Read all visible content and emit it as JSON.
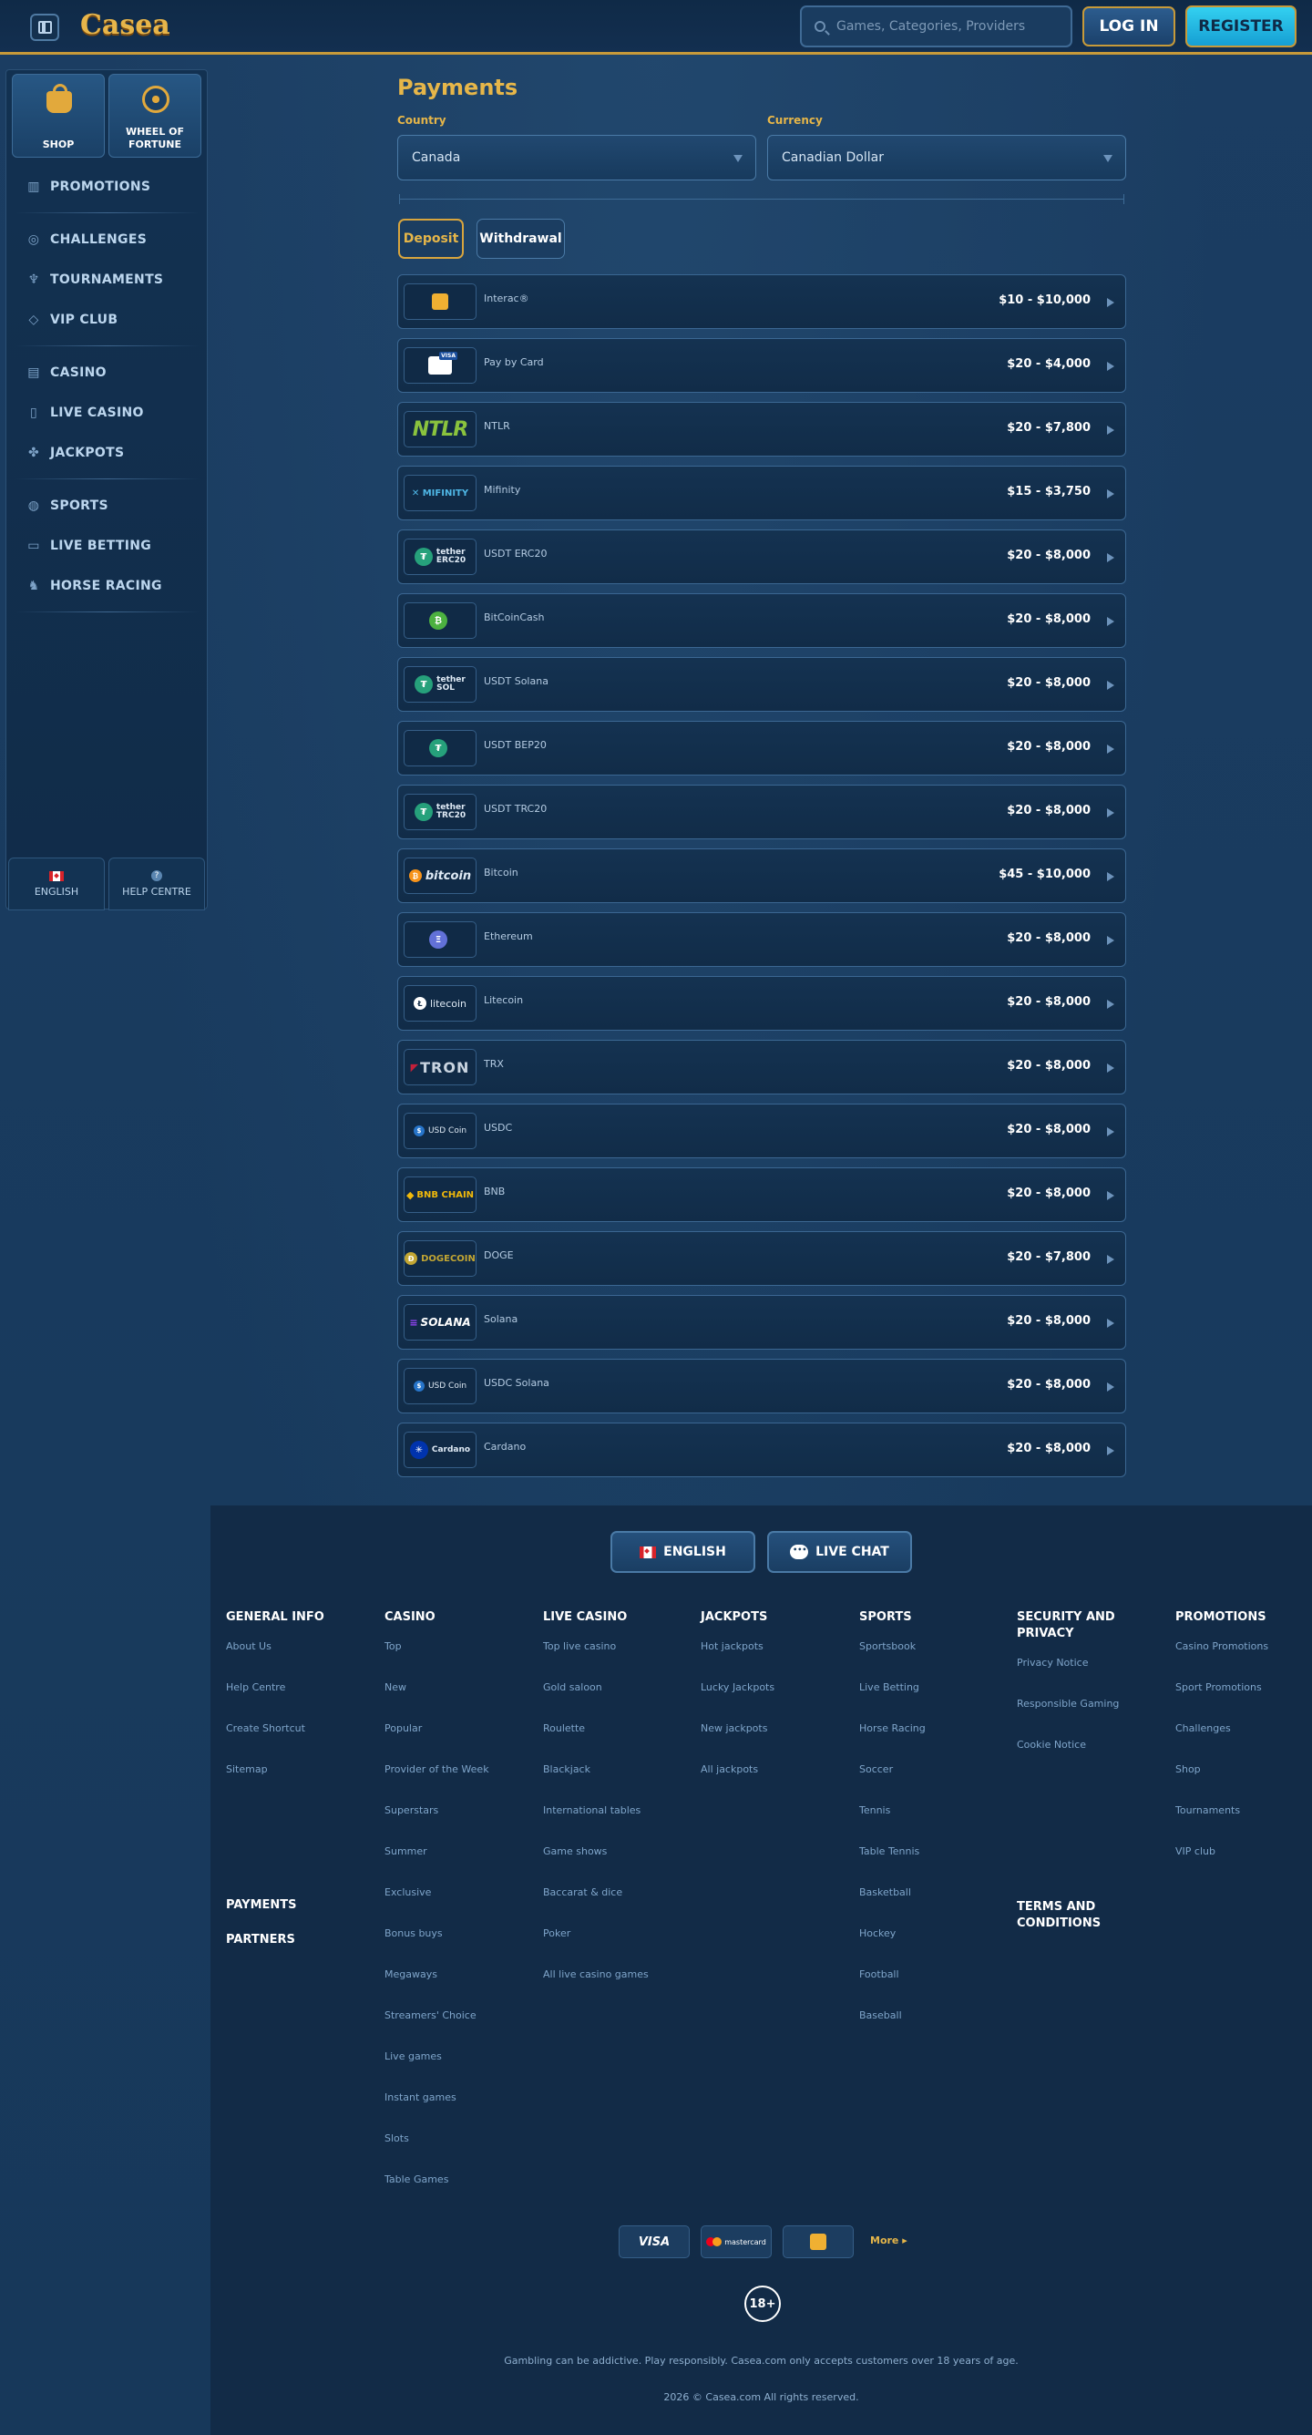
{
  "header": {
    "logo": "Casea",
    "search_placeholder": "Games, Categories, Providers",
    "login_label": "LOG IN",
    "register_label": "REGISTER"
  },
  "sidebar": {
    "tiles": [
      {
        "label": "SHOP",
        "icon": "shopping-bag-icon"
      },
      {
        "label": "WHEEL OF FORTUNE",
        "icon": "wheel-icon"
      }
    ],
    "groups": [
      [
        {
          "label": "PROMOTIONS",
          "icon": "gift-icon"
        }
      ],
      [
        {
          "label": "CHALLENGES",
          "icon": "target-icon"
        },
        {
          "label": "TOURNAMENTS",
          "icon": "trophy-icon"
        },
        {
          "label": "VIP CLUB",
          "icon": "diamond-icon"
        }
      ],
      [
        {
          "label": "CASINO",
          "icon": "slot-machine-icon"
        },
        {
          "label": "LIVE CASINO",
          "icon": "phone-icon"
        },
        {
          "label": "JACKPOTS",
          "icon": "clover-icon"
        }
      ],
      [
        {
          "label": "SPORTS",
          "icon": "ball-icon"
        },
        {
          "label": "LIVE BETTING",
          "icon": "scoreboard-icon"
        },
        {
          "label": "HORSE RACING",
          "icon": "horse-icon"
        }
      ]
    ],
    "language_label": "ENGLISH",
    "help_label": "HELP CENTRE"
  },
  "main": {
    "title": "Payments",
    "country_label": "Country",
    "country_value": "Canada",
    "currency_label": "Currency",
    "currency_value": "Canadian Dollar",
    "deposit_tab": "Deposit",
    "withdrawal_tab": "Withdrawal",
    "methods": [
      {
        "name": "Interac®",
        "range": "$10 - $10,000",
        "logo": "interac"
      },
      {
        "name": "Pay by Card",
        "range": "$20 - $4,000",
        "logo": "card"
      },
      {
        "name": "NTLR",
        "range": "$20 - $7,800",
        "logo": "ntlr",
        "logo_text": "NTLR"
      },
      {
        "name": "Mifinity",
        "range": "$15 - $3,750",
        "logo": "mifinity",
        "logo_text": "MIFINITY"
      },
      {
        "name": "USDT ERC20",
        "range": "$20 - $8,000",
        "logo": "tether-erc20",
        "logo_text": "tether",
        "logo_sub": "ERC20"
      },
      {
        "name": "BitCoinCash",
        "range": "$20 - $8,000",
        "logo": "bch"
      },
      {
        "name": "USDT Solana",
        "range": "$20 - $8,000",
        "logo": "tether-sol",
        "logo_text": "tether",
        "logo_sub": "SOL"
      },
      {
        "name": "USDT BEP20",
        "range": "$20 - $8,000",
        "logo": "tether-bep20"
      },
      {
        "name": "USDT TRC20",
        "range": "$20 - $8,000",
        "logo": "tether-trc20",
        "logo_text": "tether",
        "logo_sub": "TRC20"
      },
      {
        "name": "Bitcoin",
        "range": "$45 - $10,000",
        "logo": "bitcoin",
        "logo_text": "bitcoin"
      },
      {
        "name": "Ethereum",
        "range": "$20 - $8,000",
        "logo": "ethereum"
      },
      {
        "name": "Litecoin",
        "range": "$20 - $8,000",
        "logo": "litecoin",
        "logo_text": "litecoin"
      },
      {
        "name": "TRX",
        "range": "$20 - $8,000",
        "logo": "tron",
        "logo_text": "TRON"
      },
      {
        "name": "USDC",
        "range": "$20 - $8,000",
        "logo": "usdc",
        "logo_text": "USD Coin"
      },
      {
        "name": "BNB",
        "range": "$20 - $8,000",
        "logo": "bnb",
        "logo_text": "BNB CHAIN"
      },
      {
        "name": "DOGE",
        "range": "$20 - $7,800",
        "logo": "doge",
        "logo_text": "DOGECOIN"
      },
      {
        "name": "Solana",
        "range": "$20 - $8,000",
        "logo": "solana",
        "logo_text": "SOLANA"
      },
      {
        "name": "USDC Solana",
        "range": "$20 - $8,000",
        "logo": "usdc",
        "logo_text": "USD Coin"
      },
      {
        "name": "Cardano",
        "range": "$20 - $8,000",
        "logo": "cardano",
        "logo_text": "Cardano"
      }
    ]
  },
  "footer": {
    "language_btn": "ENGLISH",
    "chat_btn": "LIVE CHAT",
    "columns": [
      {
        "head": "GENERAL INFO",
        "links": [
          "About Us",
          "Help Centre",
          "Create Shortcut",
          "Sitemap"
        ]
      },
      {
        "head": "CASINO",
        "links": [
          "Top",
          "New",
          "Popular",
          "Provider of the Week",
          "Superstars",
          "Summer",
          "Exclusive",
          "Bonus buys",
          "Megaways",
          "Streamers' Choice",
          "Live games",
          "Instant games",
          "Slots",
          "Table Games"
        ]
      },
      {
        "head": "LIVE CASINO",
        "links": [
          "Top live casino",
          "Gold saloon",
          "Roulette",
          "Blackjack",
          "International tables",
          "Game shows",
          "Baccarat & dice",
          "Poker",
          "All live casino games"
        ]
      },
      {
        "head": "JACKPOTS",
        "links": [
          "Hot jackpots",
          "Lucky Jackpots",
          "New jackpots",
          "All jackpots"
        ]
      },
      {
        "head": "SPORTS",
        "links": [
          "Sportsbook",
          "Live Betting",
          "Horse Racing",
          "Soccer",
          "Tennis",
          "Table Tennis",
          "Basketball",
          "Hockey",
          "Football",
          "Baseball"
        ]
      },
      {
        "head": "SECURITY AND PRIVACY",
        "links": [
          "Privacy Notice",
          "Responsible Gaming",
          "Cookie Notice"
        ]
      },
      {
        "head": "PROMOTIONS",
        "links": [
          "Casino Promotions",
          "Sport Promotions",
          "Challenges",
          "Shop",
          "Tournaments",
          "VIP club"
        ]
      }
    ],
    "payments_label": "PAYMENTS",
    "partners_label": "PARTNERS",
    "terms_label": "TERMS AND CONDITIONS",
    "pay_visa": "VISA",
    "pay_mastercard": "mastercard",
    "more_label": "More ▸",
    "age_badge": "18+",
    "disclaimer": "Gambling can be addictive. Play responsibly. Casea.com only accepts customers over 18 years of age.",
    "copyright": "2026 © Casea.com All rights reserved."
  }
}
